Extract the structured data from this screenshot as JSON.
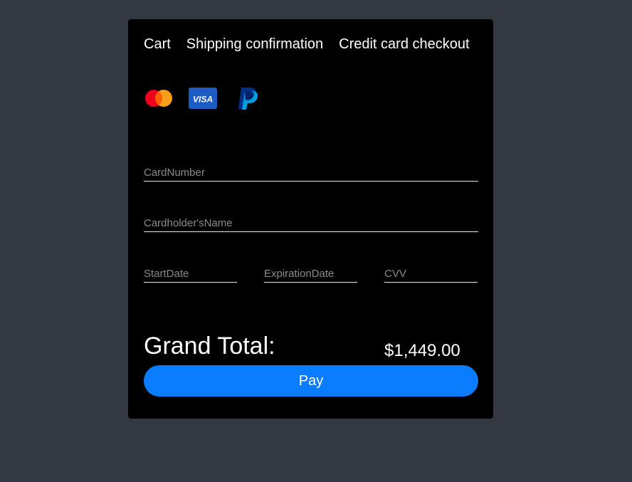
{
  "breadcrumb": {
    "items": [
      {
        "label": "Cart"
      },
      {
        "label": "Shipping confirmation"
      },
      {
        "label": "Credit card checkout"
      }
    ]
  },
  "payment_methods": {
    "icons": [
      "mastercard-icon",
      "visa-icon",
      "paypal-icon"
    ],
    "visa_text": "VISA"
  },
  "form": {
    "card_number": {
      "placeholder": "CardNumber",
      "value": ""
    },
    "cardholder_name": {
      "placeholder": "Cardholder'sName",
      "value": ""
    },
    "start_date": {
      "placeholder": "StartDate",
      "value": ""
    },
    "expiration_date": {
      "placeholder": "ExpirationDate",
      "value": ""
    },
    "cvv": {
      "placeholder": "CVV",
      "value": ""
    }
  },
  "summary": {
    "grand_total_label": "Grand Total:",
    "grand_total_value": "$1,449.00"
  },
  "actions": {
    "pay_label": "Pay"
  },
  "colors": {
    "page_background": "#343941",
    "card_background": "#000000",
    "accent": "#0a7dff",
    "mastercard_red": "#eb001b",
    "mastercard_orange": "#f79e1b",
    "visa_blue": "#1a5bc4",
    "paypal_dark": "#003087",
    "paypal_light": "#009cde"
  }
}
